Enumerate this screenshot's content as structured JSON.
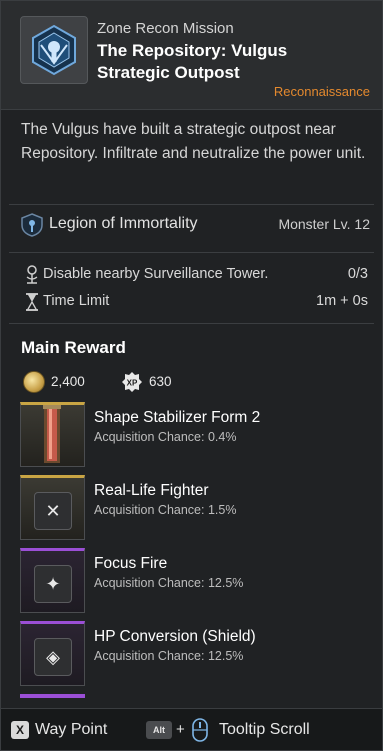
{
  "header": {
    "type": "Zone Recon Mission",
    "title": "The Repository: Vulgus Strategic Outpost",
    "tag": "Reconnaissance",
    "icon": "mission-emblem-icon",
    "tag_color": "#e4892e"
  },
  "description": "The Vulgus have built a strategic outpost near Repository. Infiltrate and neutralize the power unit.",
  "faction": {
    "name": "Legion of Immortality",
    "monster_level": "Monster Lv. 12"
  },
  "objectives": [
    {
      "label": "Disable nearby Surveillance Tower.",
      "value": "0/3",
      "icon": "tower-icon"
    },
    {
      "label": "Time Limit",
      "value": "1m + 0s",
      "icon": "hourglass-icon"
    }
  ],
  "rewards": {
    "title": "Main Reward",
    "gold": "2,400",
    "xp_badge": "XP",
    "xp": "630",
    "items": [
      {
        "name": "Shape Stabilizer Form 2",
        "chance": "Acquisition Chance: 0.4%",
        "rarity": "gold"
      },
      {
        "name": "Real-Life Fighter",
        "chance": "Acquisition Chance: 1.5%",
        "rarity": "gold"
      },
      {
        "name": "Focus Fire",
        "chance": "Acquisition Chance: 12.5%",
        "rarity": "purple"
      },
      {
        "name": "HP Conversion (Shield)",
        "chance": "Acquisition Chance: 12.5%",
        "rarity": "purple"
      }
    ]
  },
  "footer": {
    "waypoint_key": "X",
    "waypoint_label": "Way Point",
    "tooltip_key": "Alt",
    "plus": "+",
    "tooltip_label": "Tooltip Scroll"
  }
}
